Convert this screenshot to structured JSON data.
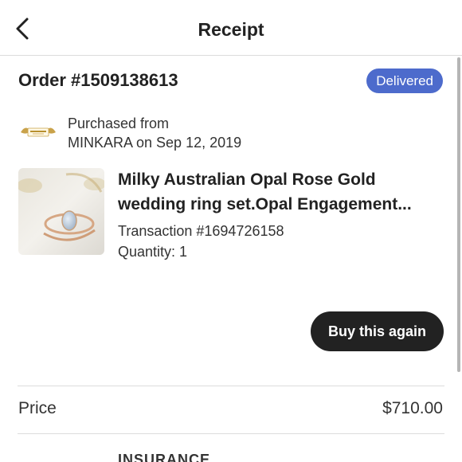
{
  "header": {
    "title": "Receipt",
    "back_icon": "chevron-left-icon"
  },
  "order": {
    "number": "Order #1509138613",
    "status": "Delivered",
    "status_color": "#4d6bcc"
  },
  "shop": {
    "purchased_from": "Purchased from",
    "line": "MINKARA on Sep 12, 2019",
    "logo_text": "MINKARA"
  },
  "product": {
    "title_line1": "Milky Australian Opal Rose Gold",
    "title_line2": "wedding ring set.Opal Engagement...",
    "transaction": "Transaction #1694726158",
    "quantity": "Quantity: 1",
    "image_icon": "ring-photo"
  },
  "actions": {
    "buy_again": "Buy this again",
    "button_color": "#222222"
  },
  "price": {
    "label": "Price",
    "value": "$710.00"
  },
  "insurance": {
    "label": "INSURANCE"
  }
}
